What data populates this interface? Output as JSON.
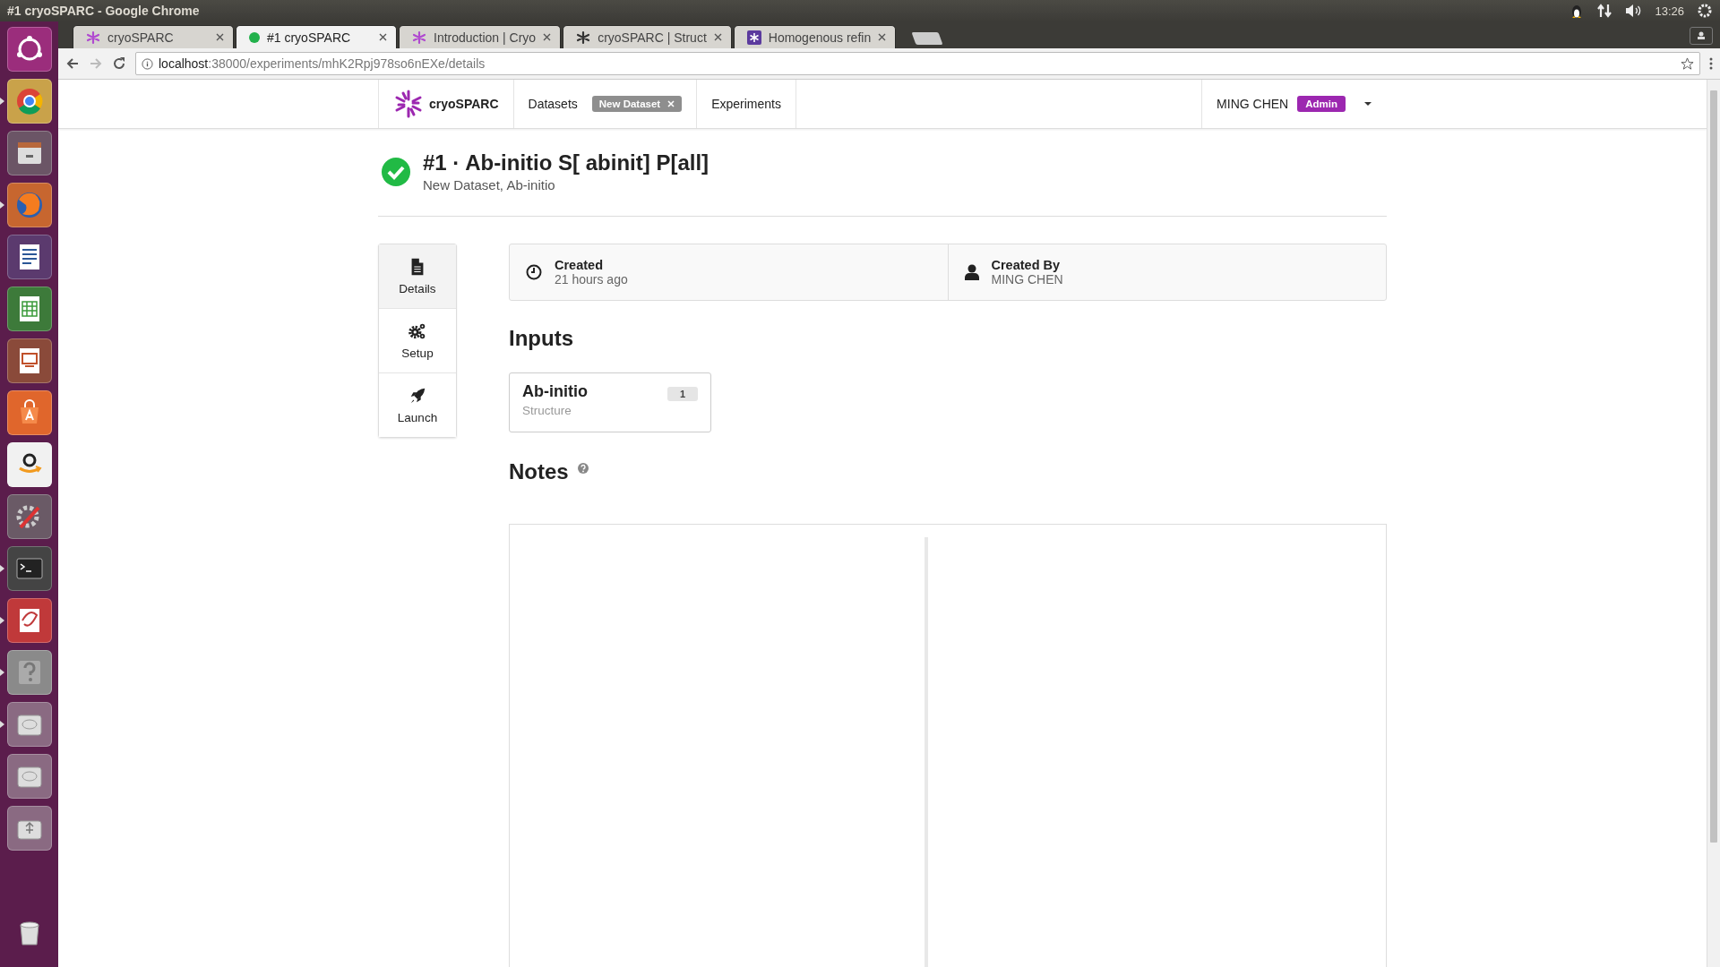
{
  "window": {
    "title": "#1 cryoSPARC - Google Chrome"
  },
  "system_tray": {
    "time": "13:26"
  },
  "launcher": [
    {
      "kind": "ubuntu",
      "running": false
    },
    {
      "kind": "chrome",
      "running": true
    },
    {
      "kind": "files",
      "running": false
    },
    {
      "kind": "firefox",
      "running": true
    },
    {
      "kind": "writer",
      "running": false
    },
    {
      "kind": "calc",
      "running": false
    },
    {
      "kind": "impress",
      "running": false
    },
    {
      "kind": "store",
      "running": false
    },
    {
      "kind": "amazon",
      "running": false
    },
    {
      "kind": "settings",
      "running": false
    },
    {
      "kind": "terminal",
      "running": true
    },
    {
      "kind": "viewer",
      "running": true
    },
    {
      "kind": "help",
      "running": true
    },
    {
      "kind": "disk",
      "running": true
    },
    {
      "kind": "disk",
      "running": false
    },
    {
      "kind": "usb",
      "running": false
    },
    {
      "kind": "trash",
      "running": false
    }
  ],
  "browser_tabs": [
    {
      "label": "cryoSPARC",
      "kind": "snowflake",
      "selected": false
    },
    {
      "label": "#1 cryoSPARC",
      "kind": "dot",
      "selected": true
    },
    {
      "label": "Introduction | Cryo",
      "kind": "snowflake",
      "selected": false
    },
    {
      "label": "cryoSPARC | Struct",
      "kind": "snowflake-dark",
      "selected": false
    },
    {
      "label": "Homogenous refin",
      "kind": "snowflake-square",
      "selected": false
    }
  ],
  "address_bar": {
    "host": "localhost",
    "path": ":38000/experiments/mhK2Rpj978so6nEXe/details"
  },
  "app_nav": {
    "brand": "cryoSPARC",
    "items": [
      {
        "label": "Datasets",
        "kind": "link"
      },
      {
        "label": "New Dataset",
        "kind": "chip"
      },
      {
        "label": "Experiments",
        "kind": "link"
      }
    ],
    "user": "MING CHEN",
    "role": "Admin"
  },
  "job": {
    "title": "#1 · Ab-initio S[ abinit] P[all]",
    "subtitle": "New Dataset, Ab-initio"
  },
  "side_tabs": [
    {
      "label": "Details",
      "kind": "document",
      "selected": true
    },
    {
      "label": "Setup",
      "kind": "gears",
      "selected": false
    },
    {
      "label": "Launch",
      "kind": "rocket",
      "selected": false
    }
  ],
  "info": [
    {
      "kind": "clock",
      "label": "Created",
      "value": "21 hours ago"
    },
    {
      "kind": "person",
      "label": "Created By",
      "value": "MING CHEN"
    }
  ],
  "inputs": {
    "heading": "Inputs",
    "items": [
      {
        "title": "Ab-initio",
        "subtitle": "Structure",
        "count": "1"
      }
    ]
  },
  "notes": {
    "heading": "Notes"
  }
}
